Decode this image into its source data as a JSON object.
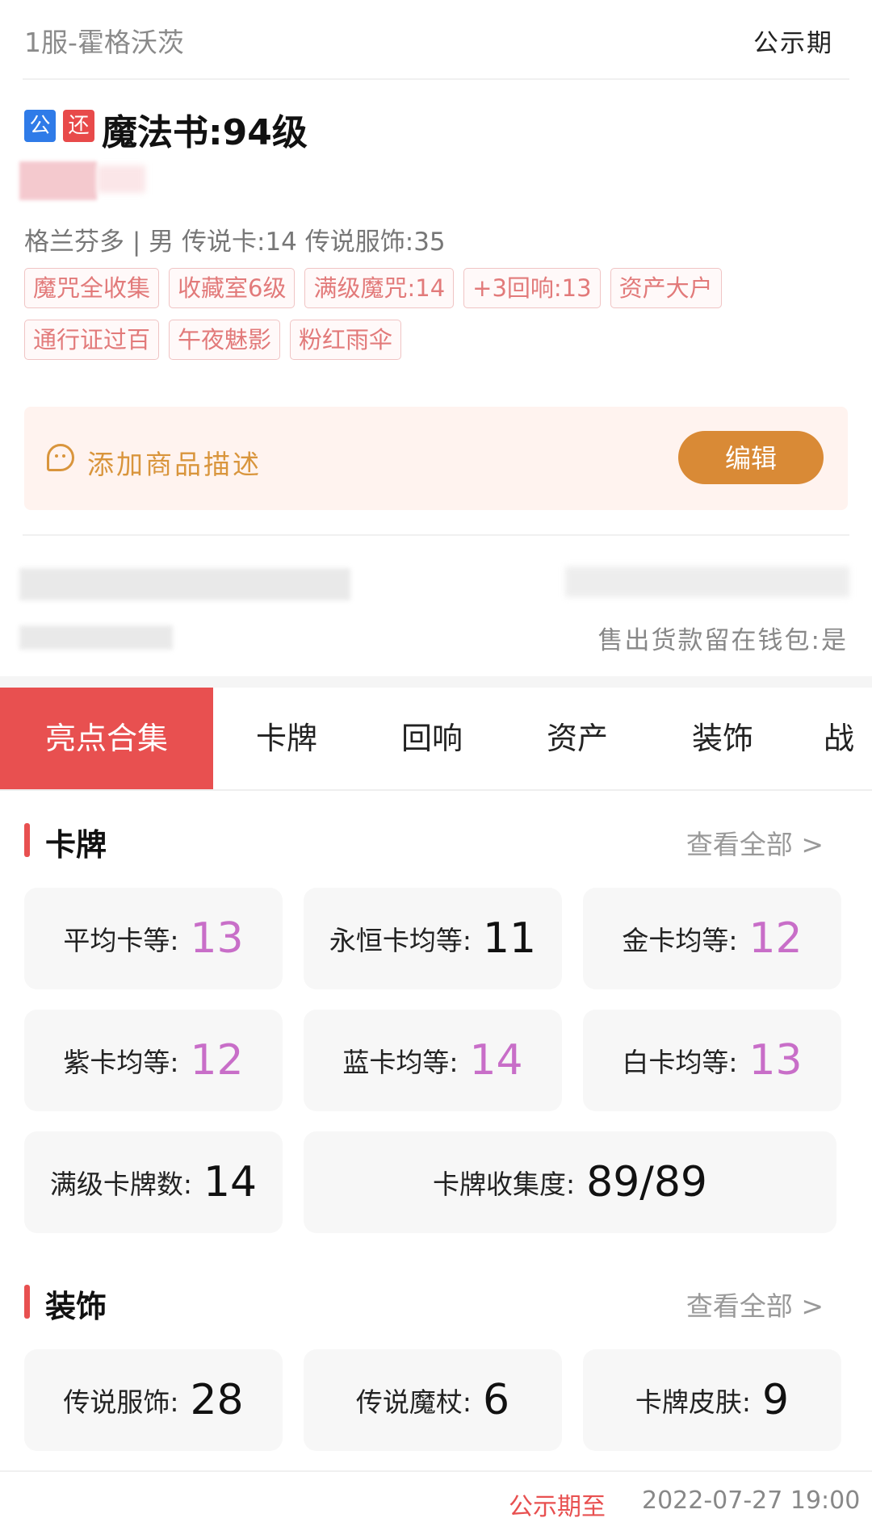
{
  "header": {
    "server": "1服-霍格沃茨",
    "status": "公示期"
  },
  "listing": {
    "badges": [
      "公",
      "还"
    ],
    "title": "魔法书:94级",
    "summary": "格兰芬多 | 男  传说卡:14  传说服饰:35",
    "tags": [
      "魔咒全收集",
      "收藏室6级",
      "满级魔咒:14",
      "+3回响:13",
      "资产大户",
      "通行证过百",
      "午夜魅影",
      "粉红雨伞"
    ]
  },
  "description": {
    "prompt": "添加商品描述",
    "edit_label": "编辑"
  },
  "wallet_note": "售出货款留在钱包:是",
  "tabs": [
    "亮点合集",
    "卡牌",
    "回响",
    "资产",
    "装饰",
    "战"
  ],
  "cards_section": {
    "title": "卡牌",
    "view_all": "查看全部 >",
    "items": [
      {
        "label": "平均卡等:",
        "value": "13",
        "color": "#c86ec8"
      },
      {
        "label": "永恒卡均等:",
        "value": "11",
        "color": "#111111"
      },
      {
        "label": "金卡均等:",
        "value": "12",
        "color": "#c86ec8"
      },
      {
        "label": "紫卡均等:",
        "value": "12",
        "color": "#c86ec8"
      },
      {
        "label": "蓝卡均等:",
        "value": "14",
        "color": "#c86ec8"
      },
      {
        "label": "白卡均等:",
        "value": "13",
        "color": "#c86ec8"
      },
      {
        "label": "满级卡牌数:",
        "value": "14",
        "color": "#111111"
      },
      {
        "label": "卡牌收集度:",
        "value": "89/89",
        "color": "#111111"
      }
    ]
  },
  "decor_section": {
    "title": "装饰",
    "view_all": "查看全部 >",
    "items": [
      {
        "label": "传说服饰:",
        "value": "28"
      },
      {
        "label": "传说魔杖:",
        "value": "6"
      },
      {
        "label": "卡牌皮肤:",
        "value": "9"
      }
    ]
  },
  "footer": {
    "label": "公示期至",
    "time": "2022-07-27 19:00"
  },
  "colors": {
    "accent": "#e85050",
    "purple_value": "#c86ec8",
    "edit_button": "#d98a36"
  }
}
